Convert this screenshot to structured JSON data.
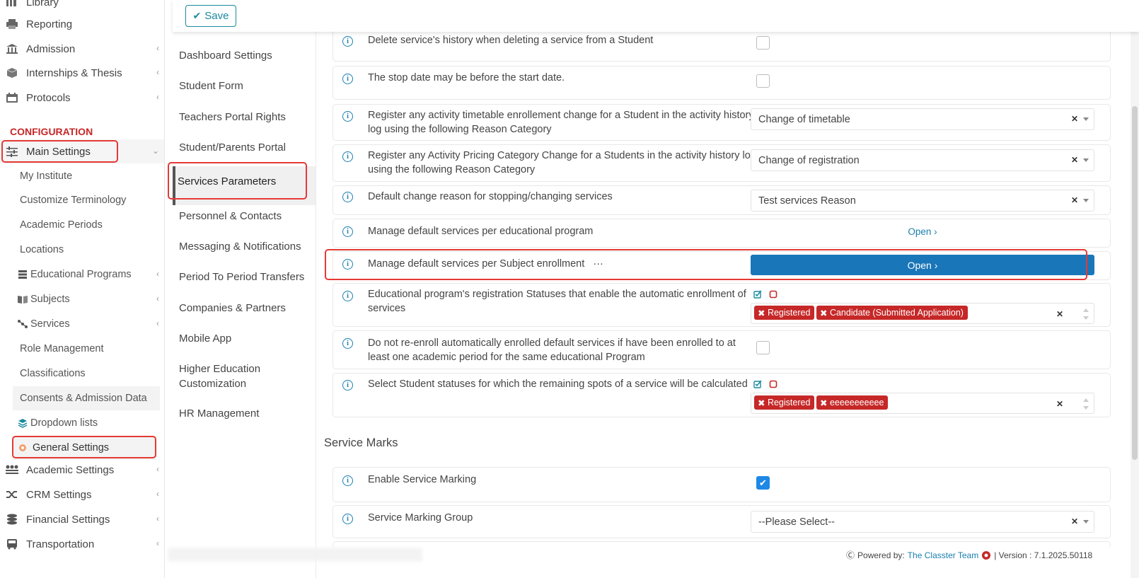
{
  "sidebar": {
    "top_items": [
      {
        "label": "Library",
        "icon": "library-icon"
      },
      {
        "label": "Reporting",
        "icon": "printer-icon"
      },
      {
        "label": "Admission",
        "icon": "bank-icon"
      },
      {
        "label": "Internships & Thesis",
        "icon": "box-icon"
      },
      {
        "label": "Protocols",
        "icon": "calendar-icon"
      }
    ],
    "config_title": "CONFIGURATION",
    "main_settings": "Main Settings",
    "sub_items": [
      "My Institute",
      "Customize Terminology",
      "Academic Periods",
      "Locations",
      "Educational Programs",
      "Subjects",
      "Services",
      "Role Management",
      "Classifications",
      "Consents & Admission Data",
      "Dropdown lists",
      "General Settings"
    ],
    "bottom_items": [
      {
        "label": "Academic Settings",
        "icon": "users-icon"
      },
      {
        "label": "CRM Settings",
        "icon": "shuffle-icon"
      },
      {
        "label": "Financial Settings",
        "icon": "coins-icon"
      },
      {
        "label": "Transportation",
        "icon": "bus-icon"
      }
    ]
  },
  "subnav": {
    "items": [
      "Dashboard Settings",
      "Student Form",
      "Teachers Portal Rights",
      "Student/Parents Portal",
      "Services Parameters",
      "Personnel & Contacts",
      "Messaging & Notifications",
      "Period To Period Transfers",
      "Companies & Partners",
      "Mobile App",
      "Higher Education Customization",
      "HR Management"
    ]
  },
  "toolbar": {
    "save_label": "Save"
  },
  "settings": {
    "r1": {
      "label": "Delete service's history when deleting a service from a Student",
      "checked": false
    },
    "r2": {
      "label": "The stop date may be before the start date.",
      "checked": false
    },
    "r3": {
      "label": "Register any activity timetable enrollement change for a Student in the activity history log using the following Reason Category",
      "value": "Change of timetable"
    },
    "r4": {
      "label": "Register any Activity Pricing Category Change for a Students in the activity history log using the following Reason Category",
      "value": "Change of registration"
    },
    "r5": {
      "label": "Default change reason for stopping/changing services",
      "value": "Test services Reason"
    },
    "r6": {
      "label": "Manage default services per educational program",
      "link": "Open"
    },
    "r7": {
      "label": "Manage default services per Subject enrollment",
      "dots": "···",
      "button": "Open"
    },
    "r8": {
      "label": "Educational program's registration Statuses that enable the automatic enrollment of services",
      "tags": [
        "Registered",
        "Candidate (Submitted Application)"
      ]
    },
    "r9": {
      "label": "Do not re-enroll automatically enrolled default services if have been enrolled to at least one academic period for the same educational Program",
      "checked": false
    },
    "r10": {
      "label": "Select Student statuses for which the remaining spots of a service will be calculated",
      "tags": [
        "Registered",
        "eeeeeeeeeee"
      ]
    }
  },
  "service_marks": {
    "title": "Service Marks",
    "enable_label": "Enable Service Marking",
    "enable_checked": true,
    "group_label": "Service Marking Group",
    "group_value": "--Please Select--"
  },
  "footer": {
    "powered": "Powered by:",
    "team": "The Classter Team",
    "version": "| Version : 7.1.2025.50118"
  },
  "colors": {
    "accent": "#1976b8",
    "danger": "#c62828",
    "teal": "#1a8a9e"
  }
}
